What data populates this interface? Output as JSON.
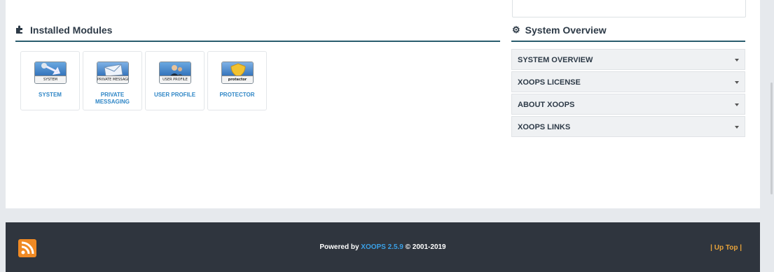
{
  "installed_modules": {
    "title": "Installed Modules",
    "modules": [
      {
        "banner": "SYSTEM",
        "label": "SYSTEM"
      },
      {
        "banner": "PRIVATE MESSAGES",
        "label": "PRIVATE MESSAGING"
      },
      {
        "banner": "USER PROFILE",
        "label": "USER PROFILE"
      },
      {
        "banner": "protector",
        "label": "PROTECTOR"
      }
    ]
  },
  "system_overview": {
    "title": "System Overview",
    "items": [
      {
        "label": "SYSTEM OVERVIEW"
      },
      {
        "label": "XOOPS LICENSE"
      },
      {
        "label": "ABOUT XOOPS"
      },
      {
        "label": "XOOPS LINKS"
      }
    ]
  },
  "footer": {
    "powered_prefix": "Powered by ",
    "powered_link": "XOOPS 2.5.9",
    "powered_suffix": " © 2001-2019",
    "up_top": "| Up Top |"
  },
  "colors": {
    "accent_line": "#2a5d6e",
    "link_blue": "#2f86c6",
    "footer_bg": "#2f353e",
    "rss_orange": "#f08a24",
    "up_top": "#e8a33a"
  }
}
